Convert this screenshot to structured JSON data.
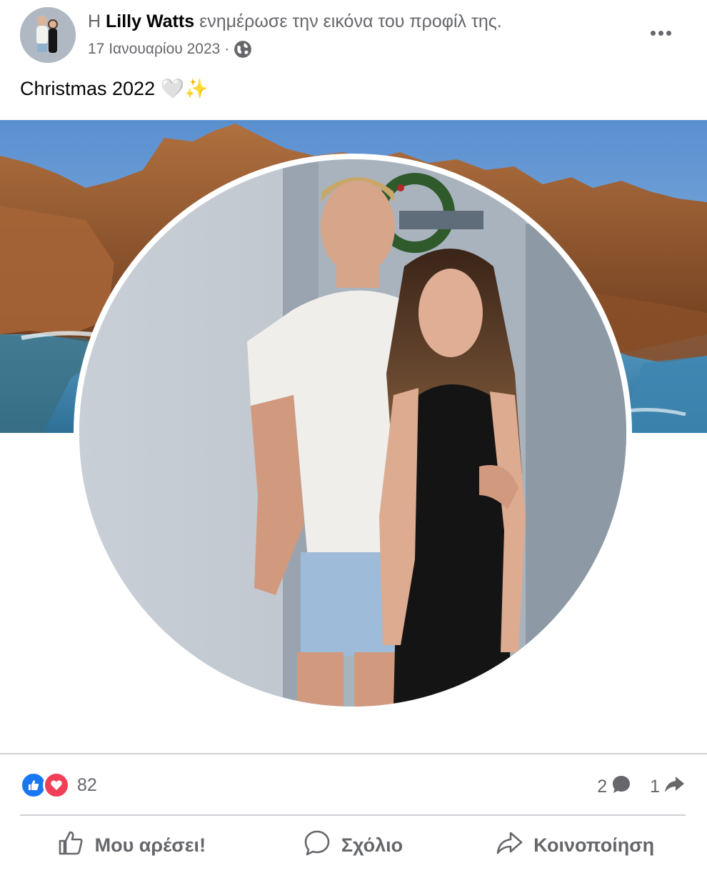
{
  "post": {
    "prefix": "Η",
    "author": "Lilly Watts",
    "action_text": "ενημέρωσε την εικόνα του προφίλ της.",
    "date": "17 Ιανουαρίου 2023",
    "separator": "·",
    "audience_icon": "globe-icon",
    "more_icon": "more-options-icon",
    "caption": "Christmas 2022 🤍✨"
  },
  "stats": {
    "reaction_icons": [
      "like-reaction-icon",
      "love-reaction-icon"
    ],
    "reaction_count": "82",
    "comment_count": "2",
    "share_count": "1"
  },
  "actions": {
    "like": "Μου αρέσει!",
    "comment": "Σχόλιο",
    "share": "Κοινοποίηση"
  },
  "colors": {
    "like_blue": "#1877f2",
    "love_red": "#f33e58",
    "secondary_text": "#65676b",
    "divider": "#ced0d4"
  }
}
